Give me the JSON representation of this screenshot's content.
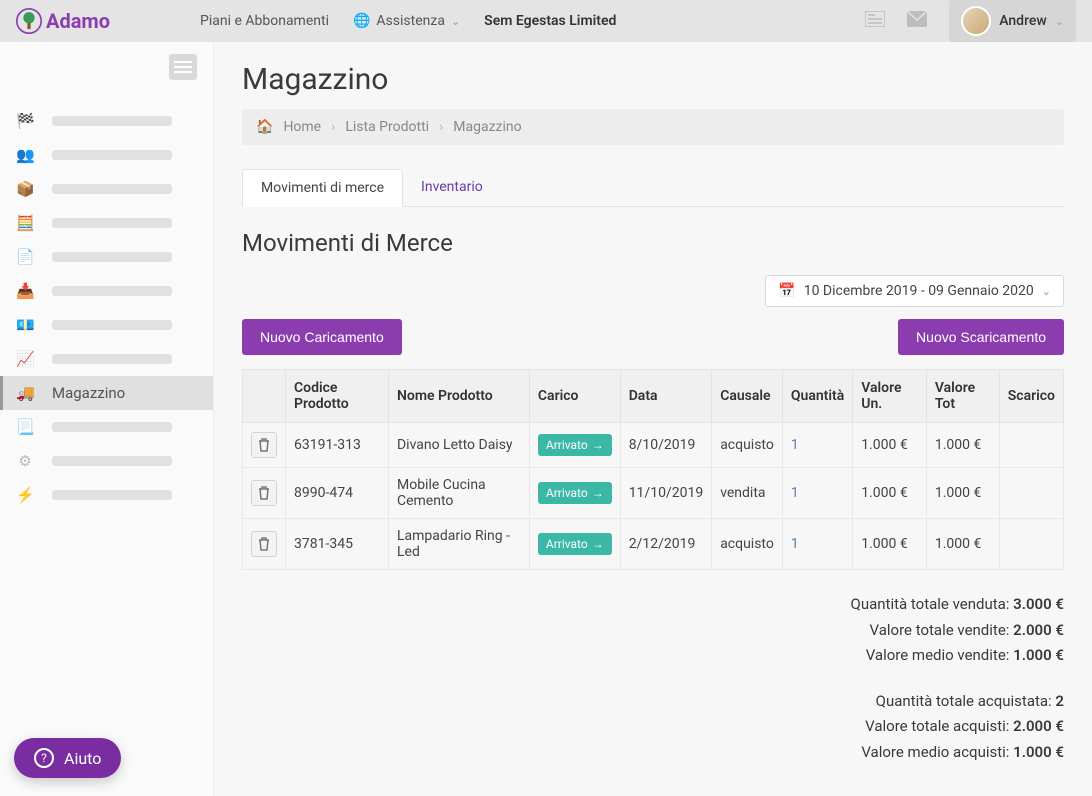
{
  "brand": "Adamo",
  "topbar": {
    "plans": "Piani e Abbonamenti",
    "assist": "Assistenza",
    "company": "Sem Egestas Limited",
    "user": "Andrew"
  },
  "sidebar": {
    "active_label": "Magazzino"
  },
  "page": {
    "title": "Magazzino",
    "breadcrumb": {
      "home": "Home",
      "list": "Lista Prodotti",
      "current": "Magazzino"
    },
    "tabs": {
      "movements": "Movimenti di merce",
      "inventory": "Inventario"
    },
    "section_title": "Movimenti di Merce",
    "date_range": "10 Dicembre 2019 - 09 Gennaio 2020",
    "buttons": {
      "new_load": "Nuovo Caricamento",
      "new_unload": "Nuovo Scaricamento"
    }
  },
  "table": {
    "headers": {
      "code": "Codice Prodotto",
      "name": "Nome Prodotto",
      "load": "Carico",
      "date": "Data",
      "reason": "Causale",
      "qty": "Quantità",
      "unit": "Valore Un.",
      "total": "Valore Tot",
      "unload": "Scarico"
    },
    "rows": [
      {
        "code": "63191-313",
        "name": "Divano Letto Daisy",
        "badge": "Arrivato",
        "date": "8/10/2019",
        "reason": "acquisto",
        "qty": "1",
        "unit": "1.000 €",
        "total": "1.000 €",
        "unload": ""
      },
      {
        "code": "8990-474",
        "name": "Mobile Cucina Cemento",
        "badge": "Arrivato",
        "date": "11/10/2019",
        "reason": "vendita",
        "qty": "1",
        "unit": "1.000 €",
        "total": "1.000 €",
        "unload": ""
      },
      {
        "code": "3781-345",
        "name": "Lampadario Ring - Led",
        "badge": "Arrivato",
        "date": "2/12/2019",
        "reason": "acquisto",
        "qty": "1",
        "unit": "1.000 €",
        "total": "1.000 €",
        "unload": ""
      }
    ]
  },
  "totals": {
    "sold": {
      "qty_label": "Quantità totale venduta:",
      "qty_val": "3.000 €",
      "val_label": "Valore totale vendite:",
      "val_val": "2.000 €",
      "avg_label": "Valore medio vendite:",
      "avg_val": "1.000 €"
    },
    "bought": {
      "qty_label": "Quantità totale acquistata:",
      "qty_val": "2",
      "val_label": "Valore totale acquisti:",
      "val_val": "2.000 €",
      "avg_label": "Valore medio acquisti:",
      "avg_val": "1.000 €"
    }
  },
  "help": "Aiuto"
}
